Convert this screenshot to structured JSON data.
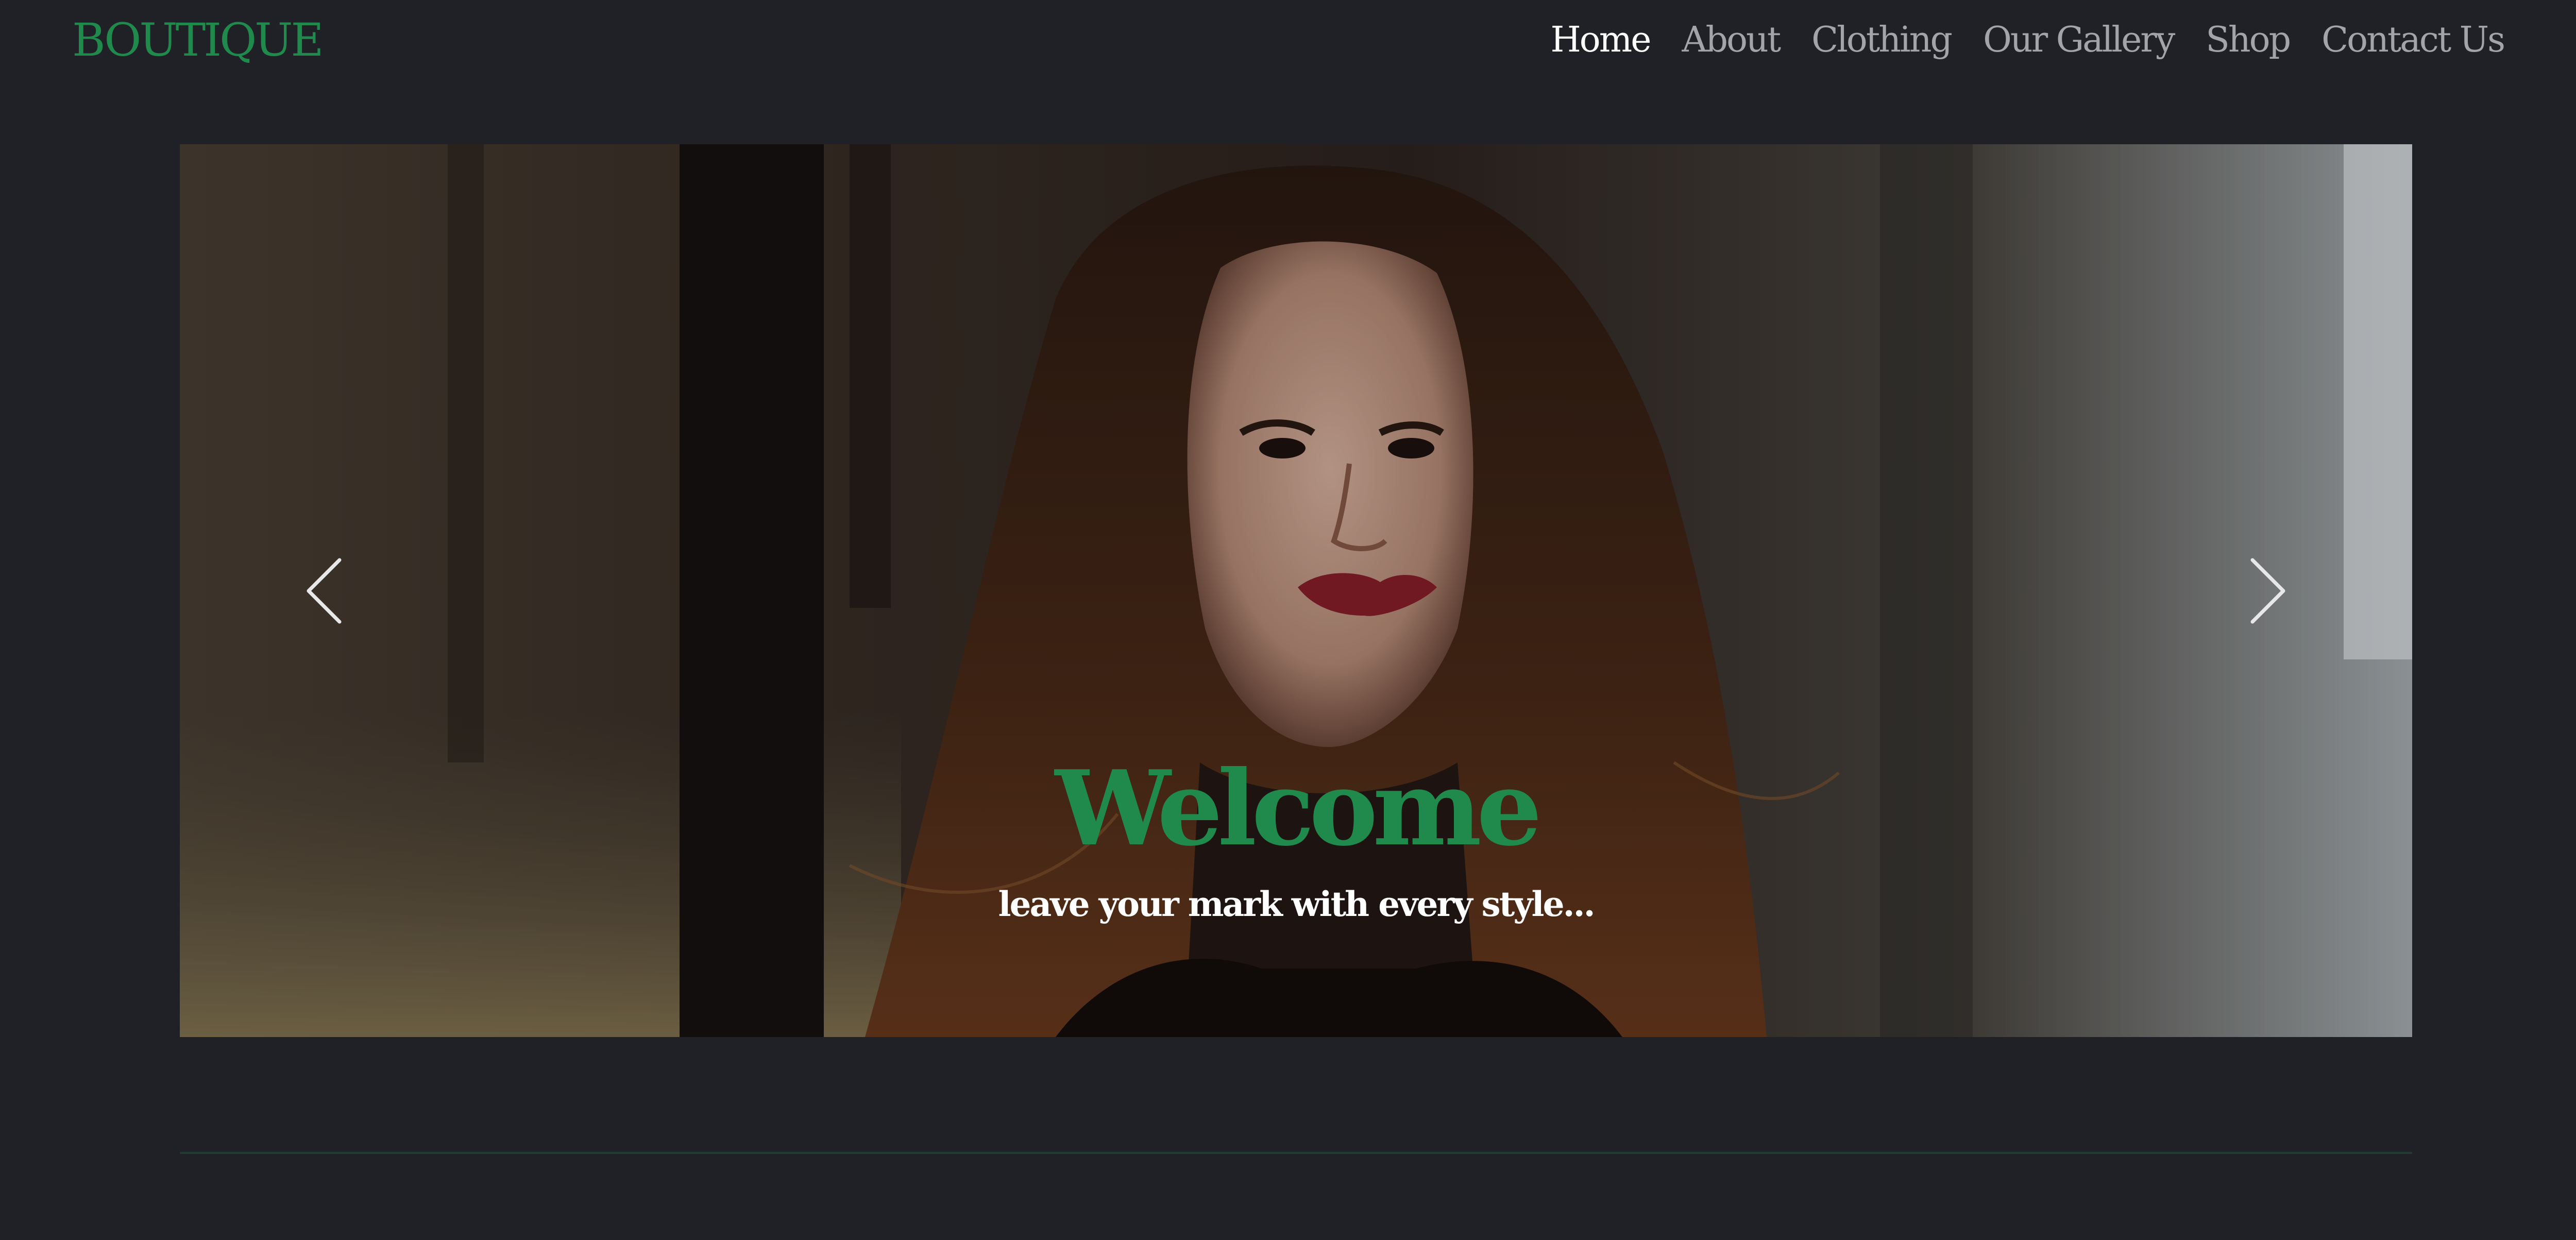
{
  "navbar": {
    "brand": "BOUTIQUE",
    "links": [
      {
        "label": "Home",
        "active": true
      },
      {
        "label": "About",
        "active": false
      },
      {
        "label": "Clothing",
        "active": false
      },
      {
        "label": "Our Gallery",
        "active": false
      },
      {
        "label": "Shop",
        "active": false
      },
      {
        "label": "Contact Us",
        "active": false
      }
    ]
  },
  "carousel": {
    "caption_title": "Welcome",
    "caption_text": "leave your mark with every style...",
    "prev_icon": "chevron-left-icon",
    "next_icon": "chevron-right-icon"
  },
  "colors": {
    "background": "#1f2126",
    "accent": "#1f8a4c",
    "nav_text": "#a2a4a8",
    "nav_active": "#ffffff"
  }
}
